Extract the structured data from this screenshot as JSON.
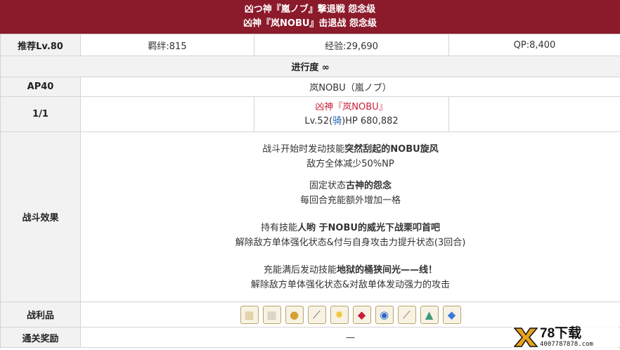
{
  "header": {
    "title_jp": "凶つ神『嵐ノブ』撃退戦 怨念级",
    "title_cn": "凶神『岚NOBU』击退战 怨念级"
  },
  "row_rec": {
    "label": "推荐Lv.80",
    "bond": "羁绊:815",
    "exp": "经验:29,690",
    "qp": "QP:8,400"
  },
  "progress": {
    "label": "进行度 ∞"
  },
  "row_ap": {
    "label": "AP40",
    "enemy_name": "岚NOBU（嵐ノブ）"
  },
  "row_wave": {
    "label": "1/1",
    "enemy_title": "凶神『岚NOBU』",
    "lv_prefix": "Lv.52(",
    "class": "骑",
    "hp_suffix": ")HP 680,882"
  },
  "effects": {
    "label": "战斗效果",
    "e1_pre": "战斗开始时发动技能",
    "e1_bold": "突然刮起的NOBU旋风",
    "e1_desc": "敌方全体减少50%NP",
    "e2_pre": "固定状态",
    "e2_bold": "古神的怨念",
    "e2_desc": "每回合充能额外增加一格",
    "e3_pre": "持有技能",
    "e3_bold": "人哟 于NOBU的威光下战栗叩首吧",
    "e3_desc": "解除敌方单体强化状态&付与自身攻击力提升状态(3回合)",
    "e4_pre": "充能满后发动技能",
    "e4_bold": "地狱的桶狭间光——线！",
    "e4_desc": "解除敌方单体强化状态&对敌单体发动强力的攻击"
  },
  "loot": {
    "label": "战利品",
    "items": [
      {
        "icon": "card-icon",
        "color": "#d8c48a"
      },
      {
        "icon": "card-icon",
        "color": "#cfc6b4"
      },
      {
        "icon": "egg-icon",
        "color": "#d6a133"
      },
      {
        "icon": "horn-icon",
        "color": "#5a5a5a"
      },
      {
        "icon": "star-icon",
        "color": "#f2c53d"
      },
      {
        "icon": "ruby-icon",
        "color": "#c8203a"
      },
      {
        "icon": "blue-orb-icon",
        "color": "#2b66c9"
      },
      {
        "icon": "claw-icon",
        "color": "#8a5a3a"
      },
      {
        "icon": "bell-icon",
        "color": "#3e9a7a"
      },
      {
        "icon": "crystal-icon",
        "color": "#3a7ad8"
      }
    ]
  },
  "clear": {
    "label": "通关奖励",
    "value": "—"
  },
  "watermark": {
    "brand": "78下载",
    "url": "4007787878.com",
    "logo_color": "#e8a21a"
  }
}
